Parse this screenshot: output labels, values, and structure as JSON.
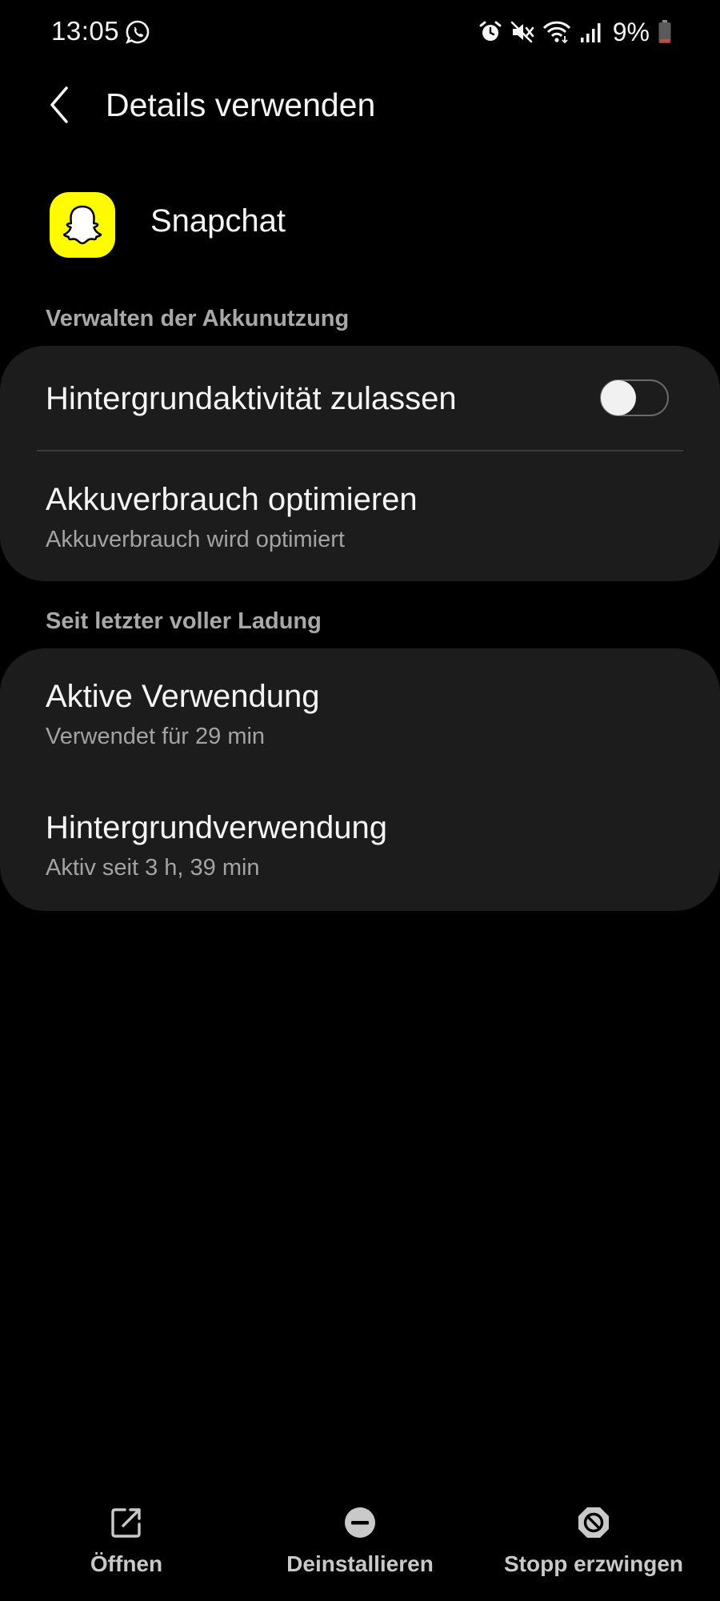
{
  "status_bar": {
    "time": "13:05",
    "battery": "9%",
    "icons": [
      "whatsapp-icon",
      "alarm-icon",
      "mute-icon",
      "wifi-icon",
      "signal-icon",
      "battery-icon"
    ]
  },
  "header": {
    "title": "Details verwenden",
    "back_icon": "chevron-left-icon"
  },
  "app": {
    "name": "Snapchat",
    "icon": "snapchat-ghost-icon",
    "icon_color": "#FFFC00"
  },
  "sections": {
    "battery_management": {
      "header": "Verwalten der Akkunutzung",
      "items": [
        {
          "title": "Hintergrundaktivität zulassen",
          "toggle_on": false
        },
        {
          "title": "Akkuverbrauch optimieren",
          "subtitle": "Akkuverbrauch wird optimiert"
        }
      ]
    },
    "since_full_charge": {
      "header": "Seit letzter voller Ladung",
      "items": [
        {
          "title": "Aktive Verwendung",
          "subtitle": "Verwendet für 29 min"
        },
        {
          "title": "Hintergrundverwendung",
          "subtitle": "Aktiv seit 3 h, 39 min"
        }
      ]
    }
  },
  "bottom_actions": [
    {
      "label": "Öffnen",
      "icon": "open-external-icon"
    },
    {
      "label": "Deinstallieren",
      "icon": "uninstall-minus-icon"
    },
    {
      "label": "Stopp erzwingen",
      "icon": "force-stop-icon"
    }
  ],
  "colors": {
    "background": "#000000",
    "card": "#1c1c1c",
    "section_header": "#a8a8a8",
    "battery_low": "#e5412f"
  }
}
